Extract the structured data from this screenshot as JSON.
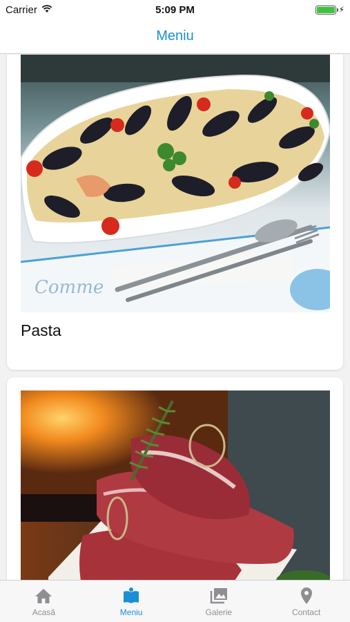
{
  "status_bar": {
    "carrier": "Carrier",
    "time": "5:09 PM"
  },
  "nav": {
    "title": "Meniu"
  },
  "menu_items": [
    {
      "label": "Pasta",
      "image": "seafood-pasta-photo"
    },
    {
      "label": "",
      "image": "raw-meat-photo"
    }
  ],
  "tabs": [
    {
      "label": "Acasă",
      "icon": "home-icon",
      "active": false
    },
    {
      "label": "Meniu",
      "icon": "menu-book-icon",
      "active": true
    },
    {
      "label": "Galerie",
      "icon": "gallery-icon",
      "active": false
    },
    {
      "label": "Contact",
      "icon": "location-pin-icon",
      "active": false
    }
  ],
  "colors": {
    "accent": "#1a8fd6",
    "inactive_tab": "#8e8e93",
    "battery": "#3ec33e"
  }
}
